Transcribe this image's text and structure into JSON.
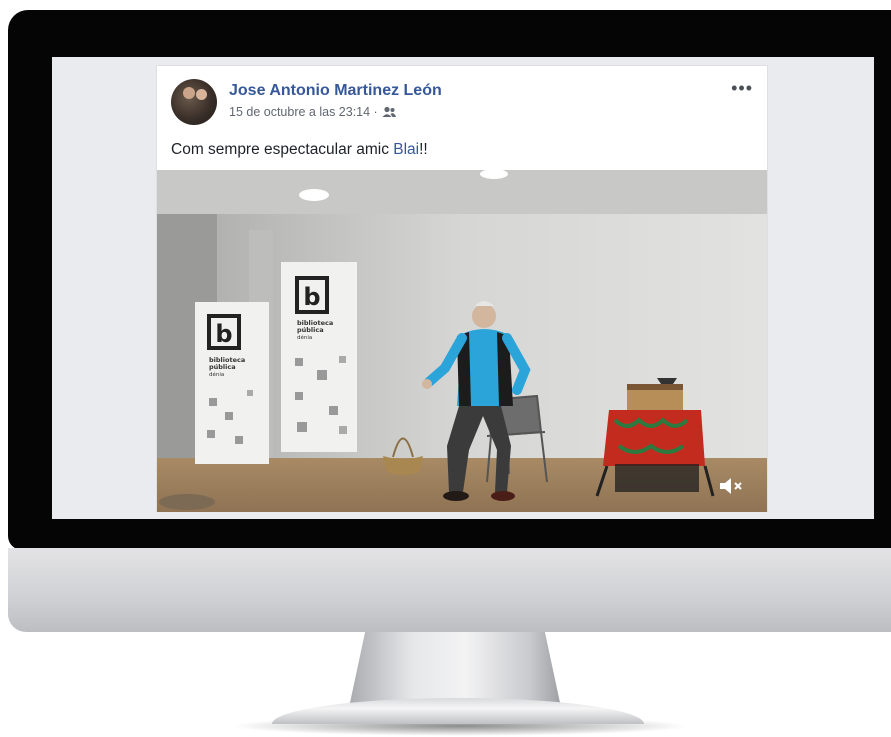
{
  "post": {
    "author": "Jose Antonio Martinez León",
    "timestamp": "15 de octubre a las 23:14 ·",
    "audience_icon": "friends-icon",
    "more_label": "•••",
    "message_text": "Com sempre espectacular amic ",
    "message_mention": "Blai",
    "message_suffix": "!!"
  },
  "video": {
    "banner_logo_letter": "b",
    "banner_text_line1": "biblioteca",
    "banner_text_line2": "pública",
    "banner_text_line3": "dénia",
    "mute_icon": "speaker-muted-icon"
  },
  "colors": {
    "link": "#365899",
    "screen_bg": "#e9ebee",
    "frame": "#050505"
  }
}
